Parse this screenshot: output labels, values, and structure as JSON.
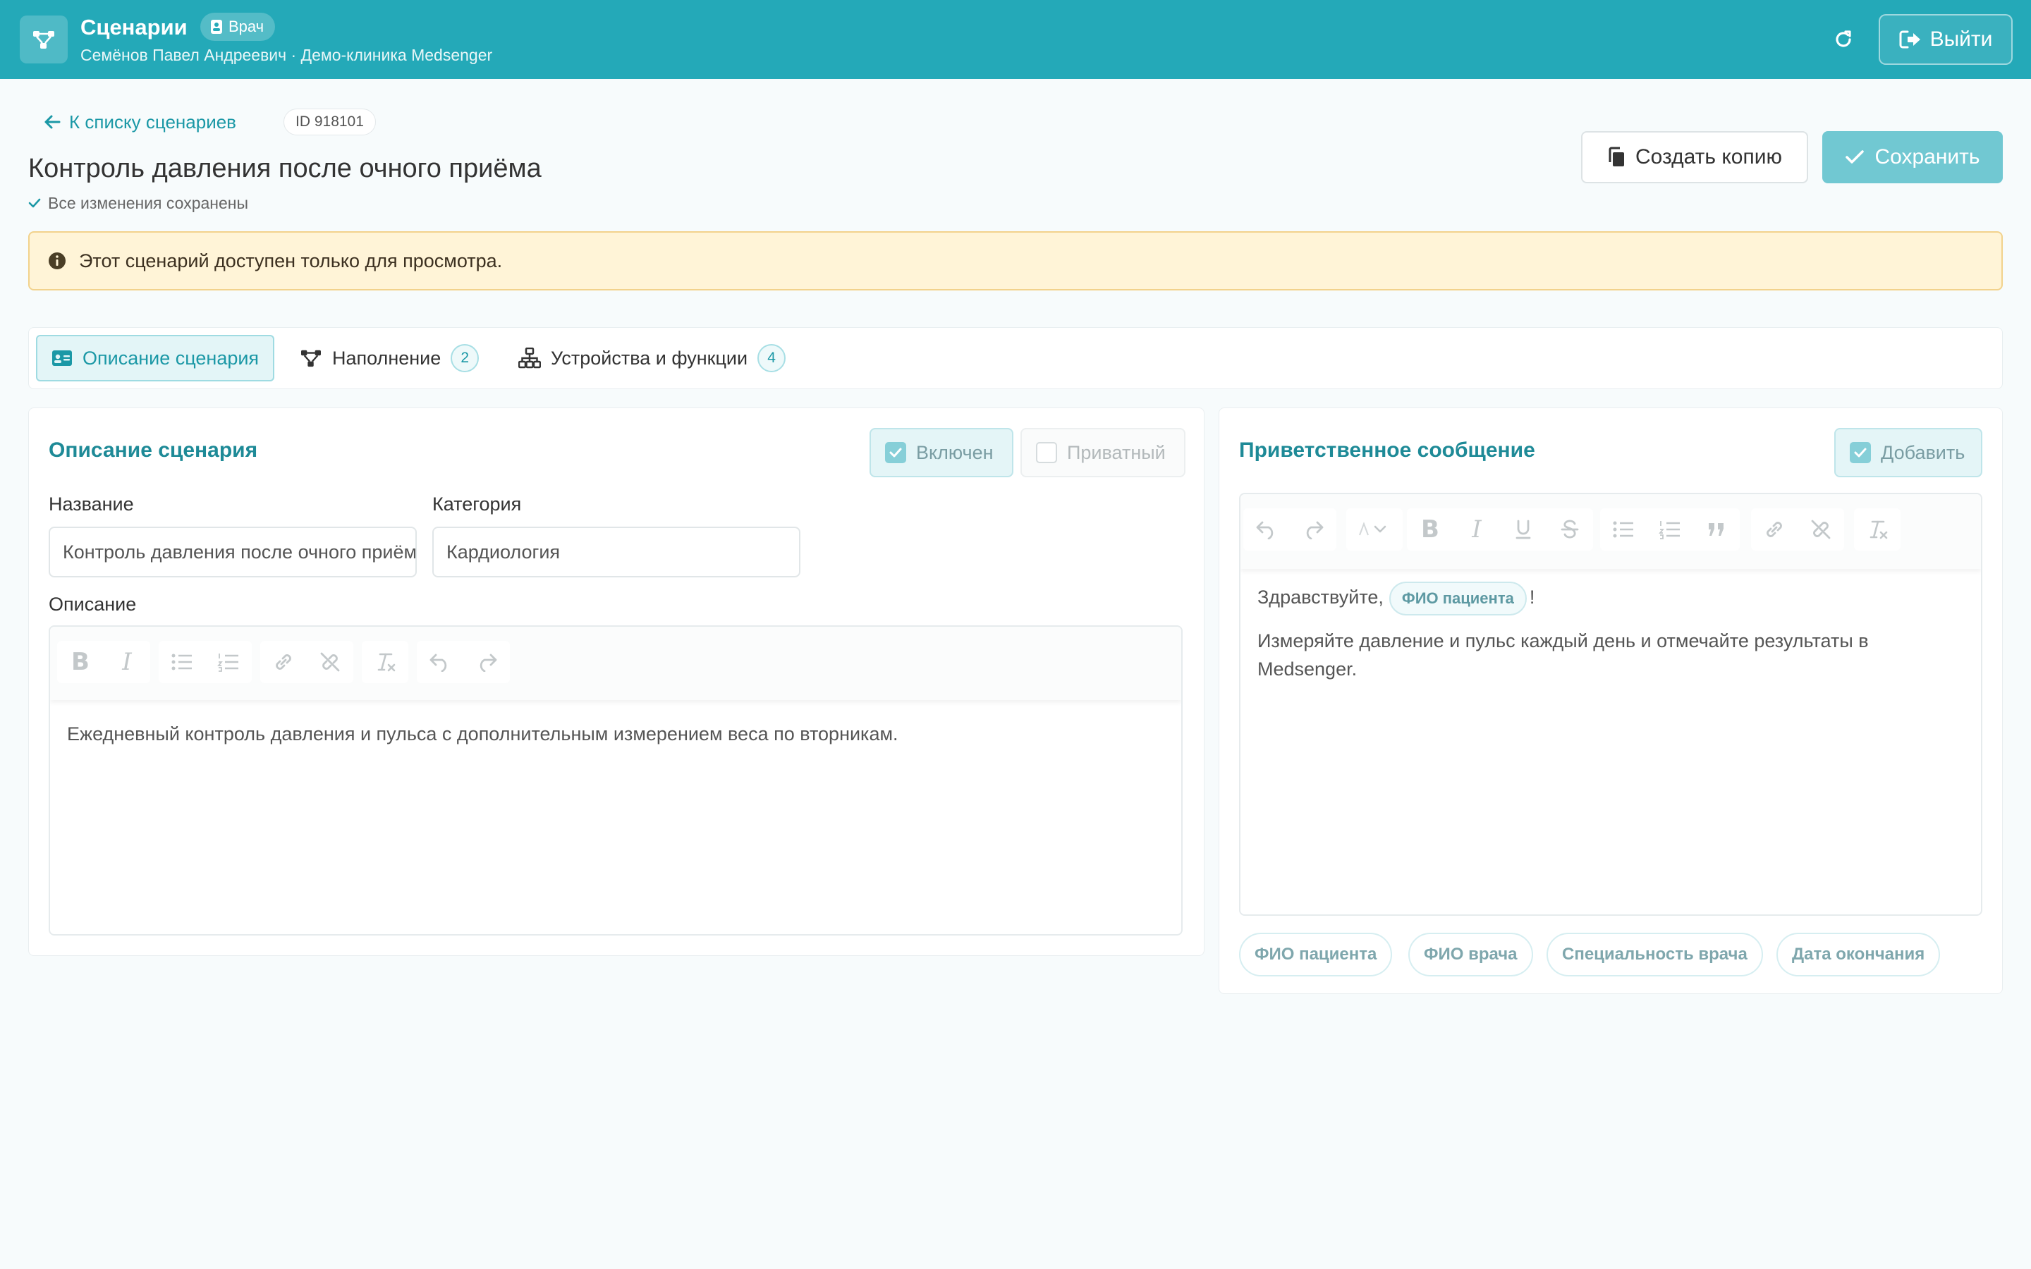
{
  "header": {
    "app_title": "Сценарии",
    "role_badge": "Врач",
    "user_line": "Семёнов Павел Андреевич · Демо-клиника Medsenger",
    "logout_label": "Выйти",
    "color": "#24a9b8"
  },
  "page": {
    "back_link": "К списку сценариев",
    "id_badge": "ID 918101",
    "title": "Контроль давления после очного приёма",
    "saved_status": "Все изменения сохранены",
    "copy_button": "Создать копию",
    "save_button": "Сохранить"
  },
  "alert": {
    "text": "Этот сценарий доступен только для просмотра."
  },
  "tabs": [
    {
      "label": "Описание сценария",
      "count": "",
      "active": true
    },
    {
      "label": "Наполнение",
      "count": "2",
      "active": false
    },
    {
      "label": "Устройства и функции",
      "count": "4",
      "active": false
    }
  ],
  "description_card": {
    "title": "Описание сценария",
    "enabled_label": "Включен",
    "enabled_checked": true,
    "private_label": "Приватный",
    "private_checked": false,
    "name_label": "Название",
    "name_value": "Контроль давления после очного приёма",
    "category_label": "Категория",
    "category_value": "Кардиология",
    "description_label": "Описание",
    "description_text": "Ежедневный контроль давления и пульса с дополнительным измерением веса по вторникам."
  },
  "greeting_card": {
    "title": "Приветственное сообщение",
    "add_label": "Добавить",
    "add_checked": true,
    "greeting_prefix": "Здравствуйте,",
    "greeting_chip": "ФИО пациента",
    "greeting_suffix": "!",
    "body_text": "Измеряйте давление и пульс каждый день и отмечайте результаты в Medsenger.",
    "variable_chips": [
      "ФИО пациента",
      "ФИО врача",
      "Специальность врача",
      "Дата окончания"
    ]
  }
}
